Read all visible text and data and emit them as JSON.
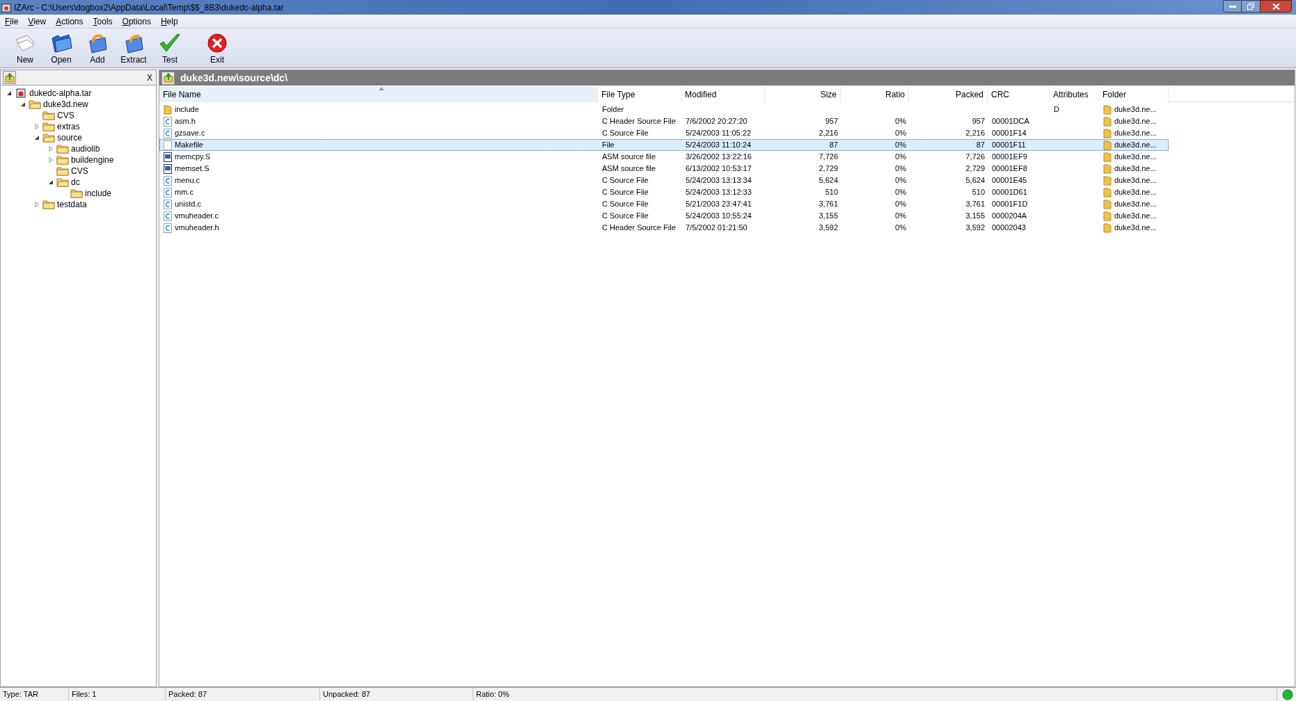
{
  "window": {
    "title": "IZArc - C:\\Users\\dogbox2\\AppData\\Local\\Temp\\$$_8B3\\dukedc-alpha.tar"
  },
  "menu": [
    "File",
    "View",
    "Actions",
    "Tools",
    "Options",
    "Help"
  ],
  "toolbar": [
    {
      "kind": "new",
      "label": "New"
    },
    {
      "kind": "open",
      "label": "Open"
    },
    {
      "kind": "add",
      "label": "Add"
    },
    {
      "kind": "extract",
      "label": "Extract"
    },
    {
      "kind": "test",
      "label": "Test"
    },
    {
      "kind": "exit",
      "label": "Exit"
    }
  ],
  "tree_pane": {
    "close": "X",
    "tree": [
      {
        "label": "dukedc-alpha.tar",
        "kind": "archive",
        "expanded": true,
        "children": [
          {
            "label": "duke3d.new",
            "kind": "folder",
            "expanded": true,
            "children": [
              {
                "label": "CVS",
                "kind": "folder"
              },
              {
                "label": "extras",
                "kind": "folder",
                "expanded": false
              },
              {
                "label": "source",
                "kind": "folder",
                "expanded": true,
                "children": [
                  {
                    "label": "audiolib",
                    "kind": "folder",
                    "expanded": false
                  },
                  {
                    "label": "buildengine",
                    "kind": "folder",
                    "expanded": false
                  },
                  {
                    "label": "CVS",
                    "kind": "folder"
                  },
                  {
                    "label": "dc",
                    "kind": "folder",
                    "expanded": true,
                    "children": [
                      {
                        "label": "include",
                        "kind": "folder"
                      }
                    ]
                  }
                ]
              },
              {
                "label": "testdata",
                "kind": "folder",
                "expanded": false
              }
            ]
          }
        ]
      }
    ]
  },
  "path": "duke3d.new\\source\\dc\\",
  "table": {
    "columns": [
      {
        "label": "File Name",
        "sorted": true
      },
      {
        "label": "File Type",
        "sorted": false
      },
      {
        "label": "Modified",
        "sorted": false
      },
      {
        "label": "Size",
        "sorted": false
      },
      {
        "label": "Ratio",
        "sorted": false
      },
      {
        "label": "Packed",
        "sorted": false
      },
      {
        "label": "CRC",
        "sorted": false
      },
      {
        "label": "Attributes",
        "sorted": false
      },
      {
        "label": "Folder",
        "sorted": false
      }
    ],
    "rows": [
      {
        "kind": "folder",
        "name": "include",
        "type": "Folder",
        "modified": "",
        "size": "",
        "ratio": "",
        "packed": "",
        "crc": "",
        "attributes": "D",
        "folder": "duke3d.ne...",
        "selected": false
      },
      {
        "kind": "c_source",
        "name": "asm.h",
        "type": "C Header Source File",
        "modified": "7/6/2002 20:27:20",
        "size": "957",
        "ratio": "0%",
        "packed": "957",
        "crc": "00001DCA",
        "attributes": "",
        "folder": "duke3d.ne...",
        "selected": false
      },
      {
        "kind": "c_source",
        "name": "gzsave.c",
        "type": "C Source File",
        "modified": "5/24/2003 11:05:22",
        "size": "2,216",
        "ratio": "0%",
        "packed": "2,216",
        "crc": "00001F14",
        "attributes": "",
        "folder": "duke3d.ne...",
        "selected": false
      },
      {
        "kind": "file",
        "name": "Makefile",
        "type": "File",
        "modified": "5/24/2003 11:10:24",
        "size": "87",
        "ratio": "0%",
        "packed": "87",
        "crc": "00001F11",
        "attributes": "",
        "folder": "duke3d.ne...",
        "selected": true
      },
      {
        "kind": "asm",
        "name": "memcpy.S",
        "type": "ASM source file",
        "modified": "3/26/2002 13:22:16",
        "size": "7,726",
        "ratio": "0%",
        "packed": "7,726",
        "crc": "00001EF9",
        "attributes": "",
        "folder": "duke3d.ne...",
        "selected": false
      },
      {
        "kind": "asm",
        "name": "memset.S",
        "type": "ASM source file",
        "modified": "6/13/2002 10:53:17",
        "size": "2,729",
        "ratio": "0%",
        "packed": "2,729",
        "crc": "00001EF8",
        "attributes": "",
        "folder": "duke3d.ne...",
        "selected": false
      },
      {
        "kind": "c_source",
        "name": "menu.c",
        "type": "C Source File",
        "modified": "5/24/2003 13:13:34",
        "size": "5,624",
        "ratio": "0%",
        "packed": "5,624",
        "crc": "00001E45",
        "attributes": "",
        "folder": "duke3d.ne...",
        "selected": false
      },
      {
        "kind": "c_source",
        "name": "mm.c",
        "type": "C Source File",
        "modified": "5/24/2003 13:12:33",
        "size": "510",
        "ratio": "0%",
        "packed": "510",
        "crc": "00001D61",
        "attributes": "",
        "folder": "duke3d.ne...",
        "selected": false
      },
      {
        "kind": "c_source",
        "name": "unistd.c",
        "type": "C Source File",
        "modified": "5/21/2003 23:47:41",
        "size": "3,761",
        "ratio": "0%",
        "packed": "3,761",
        "crc": "00001F1D",
        "attributes": "",
        "folder": "duke3d.ne...",
        "selected": false
      },
      {
        "kind": "c_source",
        "name": "vmuheader.c",
        "type": "C Source File",
        "modified": "5/24/2003 10:55:24",
        "size": "3,155",
        "ratio": "0%",
        "packed": "3,155",
        "crc": "0000204A",
        "attributes": "",
        "folder": "duke3d.ne...",
        "selected": false
      },
      {
        "kind": "c_source",
        "name": "vmuheader.h",
        "type": "C Header Source File",
        "modified": "7/5/2002 01:21:50",
        "size": "3,592",
        "ratio": "0%",
        "packed": "3,592",
        "crc": "00002043",
        "attributes": "",
        "folder": "duke3d.ne...",
        "selected": false
      }
    ]
  },
  "status_bar": [
    "Type: TAR",
    "Files: 1",
    "Packed: 87",
    "Unpacked: 87",
    "Ratio: 0%"
  ]
}
